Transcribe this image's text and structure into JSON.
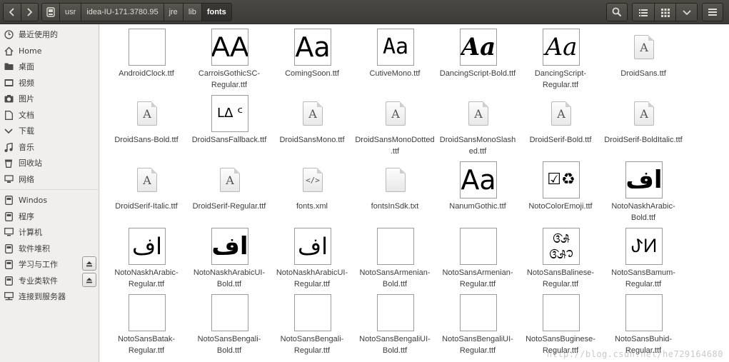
{
  "header": {
    "breadcrumbs": [
      "usr",
      "idea-IU-171.3780.95",
      "jre",
      "lib",
      "fonts"
    ],
    "active_crumb": "fonts"
  },
  "sidebar": {
    "items": [
      {
        "label": "最近使用的",
        "icon": "clock-icon"
      },
      {
        "label": "Home",
        "icon": "home-icon"
      },
      {
        "label": "桌面",
        "icon": "folder-icon"
      },
      {
        "label": "视频",
        "icon": "video-icon"
      },
      {
        "label": "图片",
        "icon": "camera-icon"
      },
      {
        "label": "文档",
        "icon": "document-icon"
      },
      {
        "label": "下载",
        "icon": "download-icon"
      },
      {
        "label": "音乐",
        "icon": "music-icon"
      },
      {
        "label": "回收站",
        "icon": "trash-icon"
      },
      {
        "label": "网络",
        "icon": "network-icon"
      },
      {
        "label": "Windos",
        "icon": "drive-icon"
      },
      {
        "label": "程序",
        "icon": "drive-icon"
      },
      {
        "label": "计算机",
        "icon": "computer-icon"
      },
      {
        "label": "软件堆积",
        "icon": "drive-icon"
      },
      {
        "label": "学习与工作",
        "icon": "drive-icon"
      },
      {
        "label": "专业类软件",
        "icon": "drive-icon"
      },
      {
        "label": "连接到服务器",
        "icon": "server-icon"
      }
    ]
  },
  "files": [
    {
      "label": "AndroidClock.ttf",
      "glyph": ""
    },
    {
      "label": "CarroisGothicSC-Regular.ttf",
      "glyph": "AA"
    },
    {
      "label": "ComingSoon.ttf",
      "glyph": "Aa"
    },
    {
      "label": "CutiveMono.ttf",
      "glyph": "Aa"
    },
    {
      "label": "DancingScript-Bold.ttf",
      "glyph": "Aa"
    },
    {
      "label": "DancingScript-Regular.ttf",
      "glyph": "Aa"
    },
    {
      "label": "DroidSans.ttf",
      "glyph": "A"
    },
    {
      "label": "DroidSans-Bold.ttf",
      "glyph": "A"
    },
    {
      "label": "DroidSansFallback.ttf",
      "glyph": "ᒪᐃ ᑦ"
    },
    {
      "label": "DroidSansMono.ttf",
      "glyph": "A"
    },
    {
      "label": "DroidSansMonoDotted.ttf",
      "glyph": "A"
    },
    {
      "label": "DroidSansMonoSlashed.ttf",
      "glyph": "A"
    },
    {
      "label": "DroidSerif-Bold.ttf",
      "glyph": "A"
    },
    {
      "label": "DroidSerif-BoldItalic.ttf",
      "glyph": "A"
    },
    {
      "label": "DroidSerif-Italic.ttf",
      "glyph": "A"
    },
    {
      "label": "DroidSerif-Regular.ttf",
      "glyph": "A"
    },
    {
      "label": "fonts.xml",
      "glyph": "</>"
    },
    {
      "label": "fontsInSdk.txt",
      "glyph": ""
    },
    {
      "label": "NanumGothic.ttf",
      "glyph": "Aa"
    },
    {
      "label": "NotoColorEmoji.ttf",
      "glyph": "☑♻"
    },
    {
      "label": "NotoNaskhArabic-Bold.ttf",
      "glyph": "اف"
    },
    {
      "label": "NotoNaskhArabic-Regular.ttf",
      "glyph": "اف"
    },
    {
      "label": "NotoNaskhArabicUI-Bold.ttf",
      "glyph": "اف"
    },
    {
      "label": "NotoNaskhArabicUI-Regular.ttf",
      "glyph": "اف"
    },
    {
      "label": "NotoSansArmenian-Bold.ttf",
      "glyph": ""
    },
    {
      "label": "NotoSansArmenian-Regular.ttf",
      "glyph": ""
    },
    {
      "label": "NotoSansBalinese-Regular.ttf",
      "glyph": "ᬅᬆ"
    },
    {
      "label": "NotoSansBamum-Regular.ttf",
      "glyph": "ꚠꚡ"
    },
    {
      "label": "NotoSansBatak-Regular.ttf",
      "glyph": ""
    },
    {
      "label": "NotoSansBengali-Bold.ttf",
      "glyph": ""
    },
    {
      "label": "NotoSansBengali-Regular.ttf",
      "glyph": ""
    },
    {
      "label": "NotoSansBengaliUI-Bold.ttf",
      "glyph": ""
    },
    {
      "label": "NotoSansBengaliUI-Regular.ttf",
      "glyph": ""
    },
    {
      "label": "NotoSansBuginese-Regular.ttf",
      "glyph": ""
    },
    {
      "label": "NotoSansBuhid-Regular.ttf",
      "glyph": ""
    }
  ],
  "watermark": "http://blog.csdn.net/he729164680"
}
